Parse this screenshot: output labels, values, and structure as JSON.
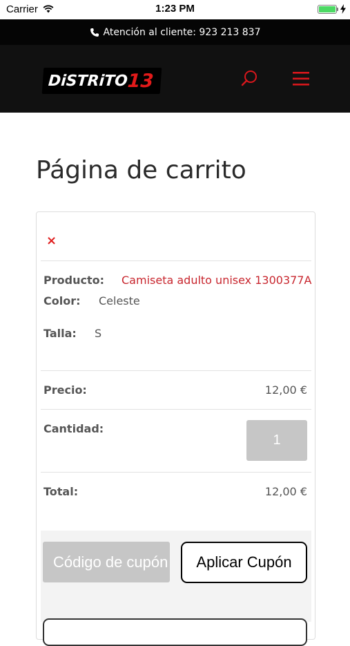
{
  "status_bar": {
    "carrier": "Carrier",
    "time": "1:23 PM",
    "battery_level": 1.0
  },
  "top_bar": {
    "text": "Atención al cliente: 923 213 837",
    "icon": "phone-icon"
  },
  "header": {
    "logo_text": "DiSTRiTO",
    "logo_number": "13",
    "search_icon": "search-icon",
    "menu_icon": "hamburger-menu-icon",
    "accent_color": "#e21a1a"
  },
  "page": {
    "title": "Página de carrito"
  },
  "cart_item": {
    "remove_symbol": "×",
    "product_label": "Producto:",
    "product_name": "Camiseta adulto unisex 1300377A",
    "color_label": "Color:",
    "color_value": "Celeste",
    "size_label": "Talla:",
    "size_value": "S",
    "price_label": "Precio:",
    "price_value": "12,00 €",
    "quantity_label": "Cantidad:",
    "quantity_value": "1",
    "total_label": "Total:",
    "total_value": "12,00 €"
  },
  "coupon": {
    "placeholder": "Código de cupón",
    "apply_label": "Aplicar Cupón"
  }
}
